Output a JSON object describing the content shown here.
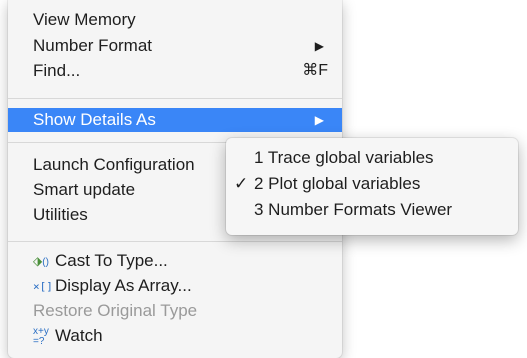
{
  "menu": {
    "view_memory": "View Memory",
    "number_format": "Number Format",
    "find": "Find...",
    "find_shortcut": "⌘F",
    "show_details_as": "Show Details As",
    "launch_configuration": "Launch Configuration",
    "smart_update": "Smart update",
    "utilities": "Utilities",
    "cast_to_type": "Cast To Type...",
    "display_as_array": "Display As Array...",
    "restore_original_type": "Restore Original Type",
    "watch": "Watch"
  },
  "submenu": {
    "items": [
      {
        "label": "1 Trace global variables",
        "checked": false
      },
      {
        "label": "2 Plot global variables",
        "checked": true
      },
      {
        "label": "3 Number Formats Viewer",
        "checked": false
      }
    ],
    "check_glyph": "✓"
  },
  "icons": {
    "cast": "cast-to-type-icon",
    "array": "display-as-array-icon",
    "watch": "watch-expression-icon",
    "submenu_arrow": "chevron-right-icon"
  },
  "colors": {
    "highlight": "#3a86f7",
    "disabled_text": "#9a9a9a"
  }
}
